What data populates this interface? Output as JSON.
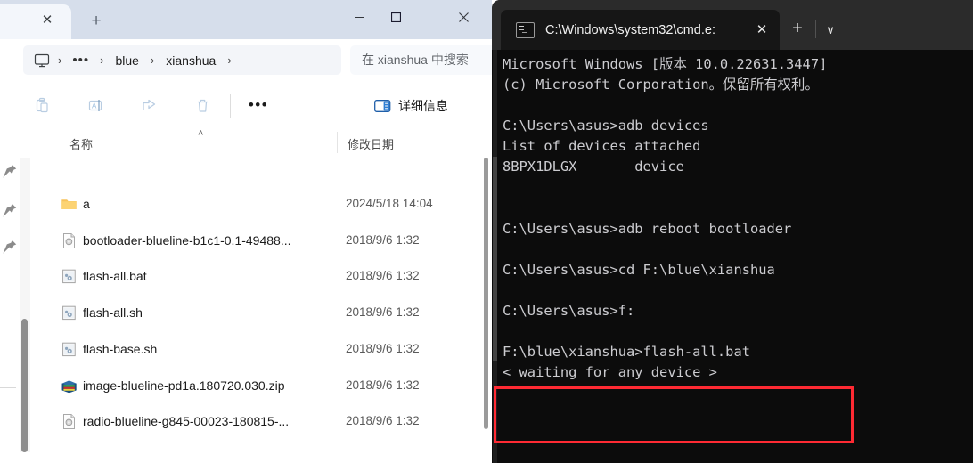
{
  "explorer": {
    "window_controls": {
      "minimize": "minimize-icon",
      "maximize": "maximize-icon",
      "close": "close-icon"
    },
    "tab": {
      "close_label": "✕",
      "new_tab_label": "+"
    },
    "address": {
      "pc_icon": "monitor-icon",
      "overflow": "•••",
      "separator": "›",
      "crumbs": [
        "blue",
        "xianshua"
      ]
    },
    "search": {
      "placeholder": "在 xianshua 中搜索"
    },
    "toolbar": {
      "buttons": [
        {
          "name": "paste-button",
          "icon": "paste-icon"
        },
        {
          "name": "rename-button",
          "icon": "rename-icon"
        },
        {
          "name": "share-button",
          "icon": "share-icon"
        },
        {
          "name": "delete-button",
          "icon": "trash-icon"
        }
      ],
      "more_label": "•••",
      "details_label": "详细信息"
    },
    "columns": {
      "name": "名称",
      "date": "修改日期",
      "sort_caret": "˄"
    },
    "files": [
      {
        "icon": "folder-icon",
        "name": "a",
        "date": "2024/5/18 14:04"
      },
      {
        "icon": "img-file-icon",
        "name": "bootloader-blueline-b1c1-0.1-49488...",
        "date": "2018/9/6 1:32"
      },
      {
        "icon": "script-file-icon",
        "name": "flash-all.bat",
        "date": "2018/9/6 1:32"
      },
      {
        "icon": "script-file-icon",
        "name": "flash-all.sh",
        "date": "2018/9/6 1:32"
      },
      {
        "icon": "script-file-icon",
        "name": "flash-base.sh",
        "date": "2018/9/6 1:32"
      },
      {
        "icon": "zip-file-icon",
        "name": "image-blueline-pd1a.180720.030.zip",
        "date": "2018/9/6 1:32"
      },
      {
        "icon": "img-file-icon",
        "name": "radio-blueline-g845-00023-180815-...",
        "date": "2018/9/6 1:32"
      }
    ]
  },
  "terminal": {
    "tab": {
      "title": "C:\\Windows\\system32\\cmd.e:",
      "icon": "console-icon",
      "close_label": "✕"
    },
    "new_tab_label": "+",
    "dropdown_label": "∨",
    "content": "Microsoft Windows [版本 10.0.22631.3447]\n(c) Microsoft Corporation。保留所有权利。\n\nC:\\Users\\asus>adb devices\nList of devices attached\n8BPX1DLGX       device\n\n\nC:\\Users\\asus>adb reboot bootloader\n\nC:\\Users\\asus>cd F:\\blue\\xianshua\n\nC:\\Users\\asus>f:\n\nF:\\blue\\xianshua>flash-all.bat\n< waiting for any device >",
    "highlight_color": "#ff2a33"
  }
}
